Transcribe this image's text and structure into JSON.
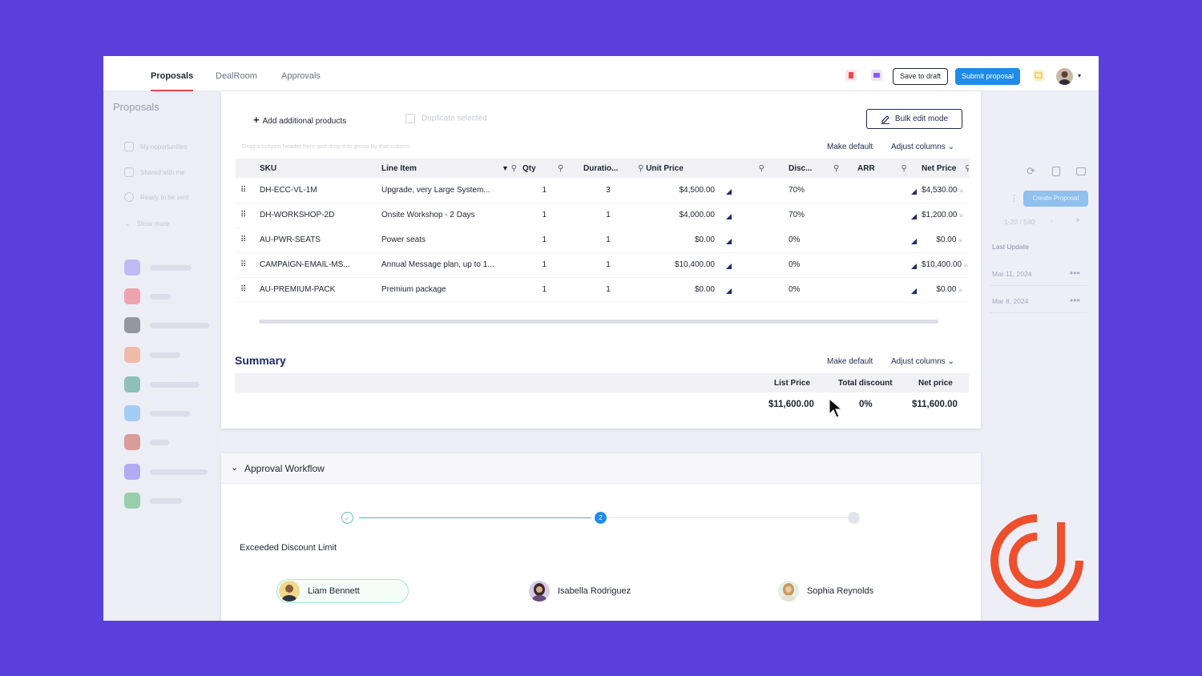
{
  "nav": {
    "tabs": [
      {
        "label": "Proposals",
        "active": true
      },
      {
        "label": "DealRoom",
        "active": false
      },
      {
        "label": "Approvals",
        "active": false
      }
    ],
    "save_draft": "Save to draft",
    "submit": "Submit proposal",
    "icons": [
      "pdf-icon",
      "preview-icon",
      "notes-icon",
      "chevron-down-icon"
    ]
  },
  "sidebar": {
    "title": "Proposals",
    "items": [
      "My opportunities",
      "Shared with me",
      "Ready to be sent",
      "Show more"
    ]
  },
  "rightpanel": {
    "create_button": "Create Proposal",
    "pagination": "1-20 / 540",
    "last_update_label": "Last Update",
    "rows": [
      "Mar 11, 2024",
      "Mar 8, 2024"
    ]
  },
  "products": {
    "add_label": "Add additional products",
    "duplicate_label": "Duplicate selected",
    "bulk_edit": "Bulk edit mode",
    "drag_hint": "Drag a column header here and drop it to group by that column",
    "make_default": "Make default",
    "adjust_columns": "Adjust columns",
    "columns": [
      "SKU",
      "Line Item",
      "Qty",
      "Duratio...",
      "Unit Price",
      "Disc...",
      "ARR",
      "Net Price"
    ],
    "rows": [
      {
        "sku": "DH-ECC-VL-1M",
        "item": "Upgrade, very Large System...",
        "qty": "1",
        "duration": "3",
        "unit": "$4,500.00",
        "disc": "70%",
        "net": "$4,530.00"
      },
      {
        "sku": "DH-WORKSHOP-2D",
        "item": "Onsite Workshop - 2 Days",
        "qty": "1",
        "duration": "1",
        "unit": "$4,000.00",
        "disc": "70%",
        "net": "$1,200.00"
      },
      {
        "sku": "AU-PWR-SEATS",
        "item": "Power seats",
        "qty": "1",
        "duration": "1",
        "unit": "$0.00",
        "disc": "0%",
        "net": "$0.00"
      },
      {
        "sku": "CAMPAIGN-EMAIL-MS...",
        "item": "Annual Message plan, up to 1...",
        "qty": "1",
        "duration": "1",
        "unit": "$10,400.00",
        "disc": "0%",
        "net": "$10,400.00"
      },
      {
        "sku": "AU-PREMIUM-PACK",
        "item": "Premium package",
        "qty": "1",
        "duration": "1",
        "unit": "$0.00",
        "disc": "0%",
        "net": "$0.00"
      }
    ]
  },
  "summary": {
    "title": "Summary",
    "make_default": "Make default",
    "adjust_columns": "Adjust columns",
    "list_price_label": "List Price",
    "total_discount_label": "Total discount",
    "net_price_label": "Net price",
    "list_price": "$11,600.00",
    "total_discount": "0%",
    "net_price": "$11,600.00"
  },
  "workflow": {
    "title": "Approval Workflow",
    "steps": [
      "",
      "2",
      ""
    ],
    "label": "Exceeded Discount Limit",
    "approvers": [
      "Liam Bennett",
      "Isabella Rodriguez",
      "Sophia Reynolds"
    ]
  },
  "colors": {
    "background": "#5b3fdc",
    "primary": "#1f8bea",
    "navy": "#1f2a6b",
    "brand": "#ee4f2c",
    "approved": "#a6e7cf"
  }
}
